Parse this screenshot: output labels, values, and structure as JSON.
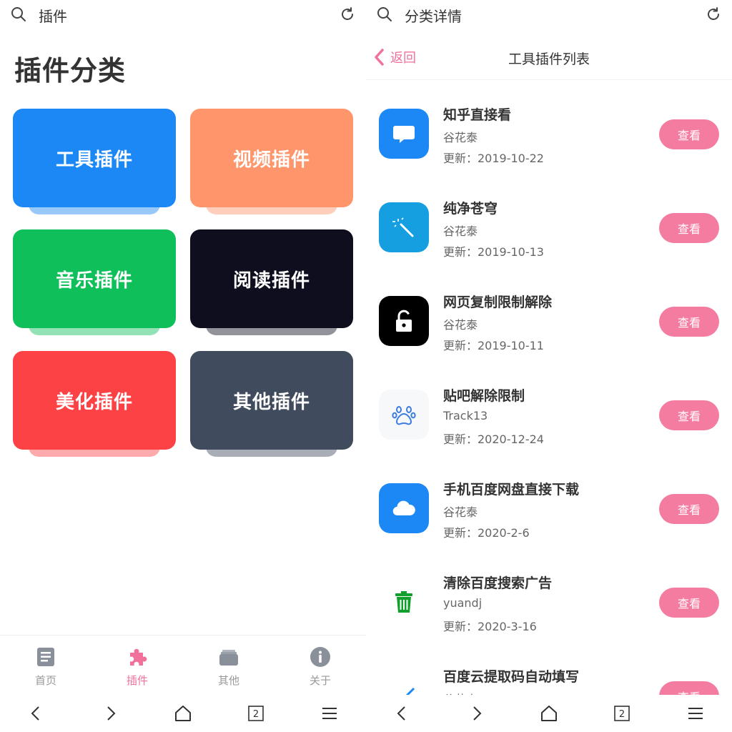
{
  "left": {
    "topbar": {
      "title": "插件"
    },
    "heading": "插件分类",
    "categories": [
      {
        "label": "工具插件",
        "color": "#1c88f5",
        "shadow": "#1c88f5"
      },
      {
        "label": "视频插件",
        "color": "#ff956b",
        "shadow": "#ff956b"
      },
      {
        "label": "音乐插件",
        "color": "#0fbf5a",
        "shadow": "#0fbf5a"
      },
      {
        "label": "阅读插件",
        "color": "#0e0e1e",
        "shadow": "#0e0e1e"
      },
      {
        "label": "美化插件",
        "color": "#fd4246",
        "shadow": "#fd4246"
      },
      {
        "label": "其他插件",
        "color": "#404b5d",
        "shadow": "#404b5d"
      }
    ],
    "tabs": [
      {
        "label": "首页",
        "icon": "document-icon",
        "active": false
      },
      {
        "label": "插件",
        "icon": "puzzle-icon",
        "active": true
      },
      {
        "label": "其他",
        "icon": "folder-icon",
        "active": false
      },
      {
        "label": "关于",
        "icon": "info-icon",
        "active": false
      }
    ],
    "navbar": {
      "tab_count": "2"
    }
  },
  "right": {
    "topbar": {
      "title": "分类详情"
    },
    "back_label": "返回",
    "list_title": "工具插件列表",
    "view_label": "查看",
    "items": [
      {
        "name": "知乎直接看",
        "author": "谷花泰",
        "date": "更新：2019-10-22",
        "icon": "chat-bubble-icon"
      },
      {
        "name": "纯净苍穹",
        "author": "谷花泰",
        "date": "更新：2019-10-13",
        "icon": "magic-wand-icon"
      },
      {
        "name": "网页复制限制解除",
        "author": "谷花泰",
        "date": "更新：2019-10-11",
        "icon": "unlock-icon"
      },
      {
        "name": "贴吧解除限制",
        "author": "Track13",
        "date": "更新：2020-12-24",
        "icon": "paw-icon"
      },
      {
        "name": "手机百度网盘直接下载",
        "author": "谷花泰",
        "date": "更新：2020-2-6",
        "icon": "cloud-icon"
      },
      {
        "name": "清除百度搜索广告",
        "author": "yuandj",
        "date": "更新：2020-3-16",
        "icon": "trash-icon"
      },
      {
        "name": "百度云提取码自动填写",
        "author": "谷花泰",
        "date": "",
        "icon": "pen-icon"
      }
    ],
    "navbar": {
      "tab_count": "2"
    }
  }
}
